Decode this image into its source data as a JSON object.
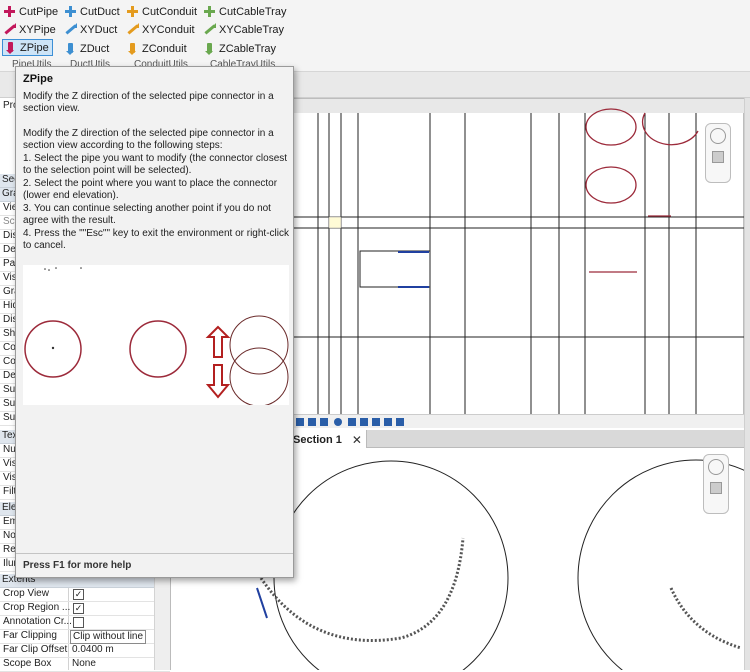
{
  "ribbon": {
    "groups": [
      {
        "label": "PipeUtils",
        "buttons": [
          {
            "label": "CutPipe",
            "icon": "cut-pipe-icon"
          },
          {
            "label": "XYPipe",
            "icon": "xy-pipe-icon"
          },
          {
            "label": "ZPipe",
            "icon": "z-pipe-icon",
            "selected": true
          }
        ]
      },
      {
        "label": "DuctUtils",
        "buttons": [
          {
            "label": "CutDuct",
            "icon": "cut-duct-icon"
          },
          {
            "label": "XYDuct",
            "icon": "xy-duct-icon"
          },
          {
            "label": "ZDuct",
            "icon": "z-duct-icon"
          }
        ]
      },
      {
        "label": "ConduitUtils",
        "buttons": [
          {
            "label": "CutConduit",
            "icon": "cut-conduit-icon"
          },
          {
            "label": "XYConduit",
            "icon": "xy-conduit-icon"
          },
          {
            "label": "ZConduit",
            "icon": "z-conduit-icon"
          }
        ]
      },
      {
        "label": "CableTrayUtils",
        "buttons": [
          {
            "label": "CutCableTray",
            "icon": "cut-cabletray-icon"
          },
          {
            "label": "XYCableTray",
            "icon": "xy-cabletray-icon"
          },
          {
            "label": "ZCableTray",
            "icon": "z-cabletray-icon"
          }
        ]
      }
    ]
  },
  "tooltip": {
    "title": "ZPipe",
    "summary": "Modify the Z direction of the selected pipe connector in a section view.",
    "details": "Modify the Z direction of the selected pipe connector in a section view according to the following steps:",
    "steps": [
      "1. Select the pipe you want to modify (the connector closest to the selection point will be selected).",
      "2. Select the point where you want to place the connector (lower end elevation).",
      "3. You can continue selecting another point if you do not agree with the result.",
      "4. Press the \"\"Esc\"\" key to exit the environment or right-click to cancel."
    ],
    "help": "Press F1 for more help"
  },
  "properties": {
    "partial_rows": [
      "Prop",
      "Sect",
      "Grap",
      "Vie",
      "Sca",
      "Dis",
      "Det",
      "Par",
      "Visi",
      "Gra",
      "Hid",
      "Dis",
      "Sho",
      "Col",
      "Col",
      "Def",
      "Sub",
      "Sub",
      "Sun",
      "Text",
      "Nu",
      "Visi",
      "Visi",
      "Filt",
      "Elect",
      "Em",
      "No",
      "Reg",
      "Ilur"
    ],
    "extents_label": "Extents",
    "rows": [
      {
        "name": "Crop View",
        "checked": true
      },
      {
        "name": "Crop Region ...",
        "checked": true
      },
      {
        "name": "Annotation Cr...",
        "checked": false
      },
      {
        "name": "Far Clipping",
        "value": "Clip without line"
      },
      {
        "name": "Far Clip Offset",
        "value": "0.0400 m"
      },
      {
        "name": "Scope Box",
        "value": "None"
      }
    ]
  },
  "views": {
    "section_tab": "Section 1",
    "tab_close": "✕"
  },
  "colors": {
    "pipe_icon": "#c2185b",
    "duct_icon": "#3d8fd1",
    "conduit_icon": "#e49b1e",
    "cabletray_icon": "#6aa84f",
    "pipe_section": "#9c2a3a",
    "selection": "#3c8fd6"
  }
}
